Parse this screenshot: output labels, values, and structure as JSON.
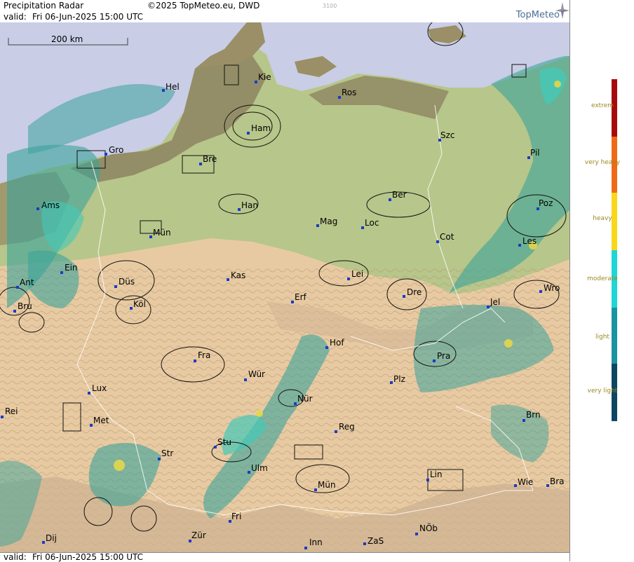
{
  "header": {
    "title": "Precipitation Radar",
    "copyright": "©2025 TopMeteo.eu, DWD",
    "code": "3100",
    "valid_label": "valid:",
    "valid_time": "Fri   06-Jun-2025 15:00 UTC",
    "logo": "TopMeteo"
  },
  "footer": {
    "valid_label": "valid:",
    "valid_time": "Fri   06-Jun-2025 15:00 UTC"
  },
  "map": {
    "scale_label": "200 km",
    "cities": [
      "Hel",
      "Kie",
      "Ros",
      "Ham",
      "Szc",
      "Gro",
      "Bre",
      "Pil",
      "Ams",
      "Han",
      "Ber",
      "Poz",
      "Mün",
      "Mag",
      "Loc",
      "Cot",
      "Les",
      "Ein",
      "Kas",
      "Lei",
      "Ant",
      "Düs",
      "Wro",
      "Bru",
      "Köl",
      "Erf",
      "Dre",
      "Jel",
      "Hof",
      "Fra",
      "Pra",
      "Wür",
      "Plz",
      "Lux",
      "Nür",
      "Rei",
      "Met",
      "Brn",
      "Reg",
      "Stu",
      "Str",
      "Ulm",
      "Lin",
      "Mün",
      "Wie",
      "Bra",
      "Fri",
      "Zür",
      "NÖb",
      "Dij",
      "Inn",
      "ZaS"
    ]
  },
  "legend": {
    "levels": [
      {
        "label": "extrem",
        "color": "#a8090a"
      },
      {
        "label": "very heavy",
        "color": "#ef6a16"
      },
      {
        "label": "heavy",
        "color": "#f9d71a"
      },
      {
        "label": "moderate",
        "color": "#1ed6d6"
      },
      {
        "label": "light",
        "color": "#1a93a2"
      },
      {
        "label": "very light",
        "color": "#0d4663"
      }
    ]
  },
  "colors": {
    "sea": "#c9cde6",
    "lowland_dark": "#8d8460",
    "lowland_green": "#b7c68a",
    "hills": "#e8caa2",
    "mountains": "#cdb190",
    "radar_light": "#3aa39a",
    "radar_moderate": "#45c9b8"
  }
}
